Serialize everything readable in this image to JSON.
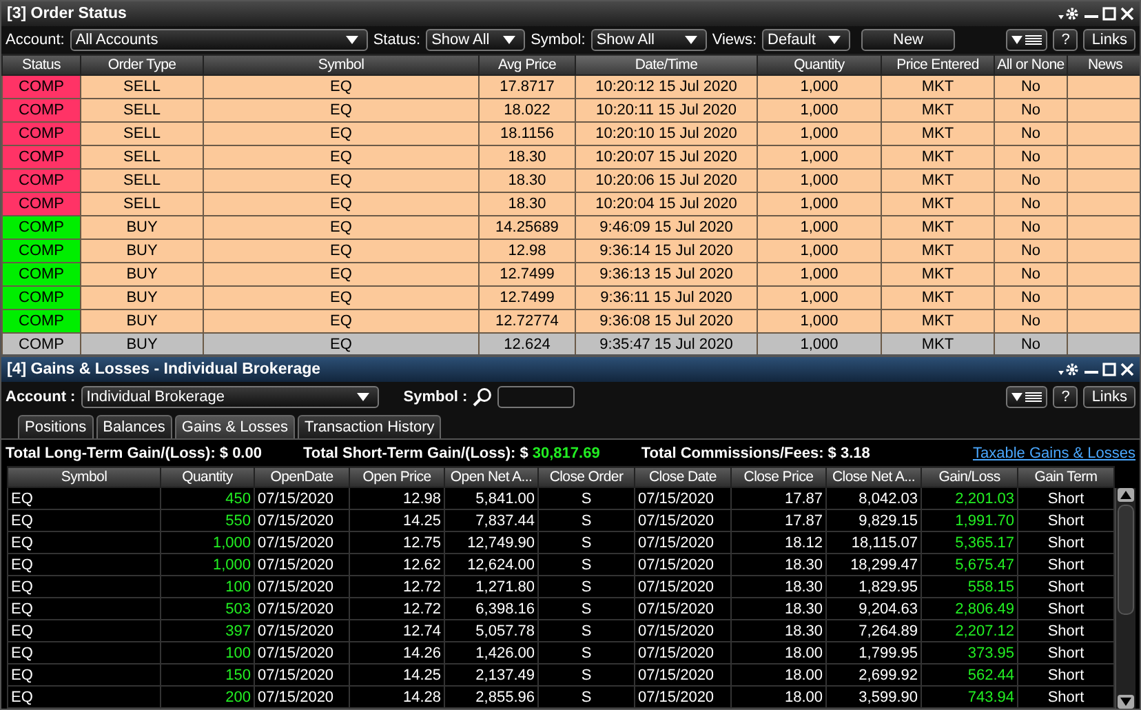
{
  "order_status": {
    "title": "[3] Order Status",
    "toolbar": {
      "account_label": "Account:",
      "account_value": "All Accounts",
      "status_label": "Status:",
      "status_value": "Show All",
      "symbol_label": "Symbol:",
      "symbol_value": "Show All",
      "views_label": "Views:",
      "views_value": "Default",
      "new_button": "New",
      "help_button": "?",
      "links_button": "Links"
    },
    "columns": [
      "Status",
      "Order Type",
      "Symbol",
      "Avg Price",
      "Date/Time",
      "Quantity",
      "Price Entered",
      "All or None",
      "News"
    ],
    "rows": [
      {
        "status": "COMP",
        "color": "#ff3366",
        "order_type": "SELL",
        "symbol": "EQ",
        "avg_price": "17.8717",
        "datetime": "10:20:12 15 Jul 2020",
        "quantity": "1,000",
        "price_entered": "MKT",
        "all_or_none": "No",
        "selected": false
      },
      {
        "status": "COMP",
        "color": "#ff3366",
        "order_type": "SELL",
        "symbol": "EQ",
        "avg_price": "18.022",
        "datetime": "10:20:11 15 Jul 2020",
        "quantity": "1,000",
        "price_entered": "MKT",
        "all_or_none": "No",
        "selected": false
      },
      {
        "status": "COMP",
        "color": "#ff3366",
        "order_type": "SELL",
        "symbol": "EQ",
        "avg_price": "18.1156",
        "datetime": "10:20:10 15 Jul 2020",
        "quantity": "1,000",
        "price_entered": "MKT",
        "all_or_none": "No",
        "selected": false
      },
      {
        "status": "COMP",
        "color": "#ff3366",
        "order_type": "SELL",
        "symbol": "EQ",
        "avg_price": "18.30",
        "datetime": "10:20:07 15 Jul 2020",
        "quantity": "1,000",
        "price_entered": "MKT",
        "all_or_none": "No",
        "selected": false
      },
      {
        "status": "COMP",
        "color": "#ff3366",
        "order_type": "SELL",
        "symbol": "EQ",
        "avg_price": "18.30",
        "datetime": "10:20:06 15 Jul 2020",
        "quantity": "1,000",
        "price_entered": "MKT",
        "all_or_none": "No",
        "selected": false
      },
      {
        "status": "COMP",
        "color": "#ff3366",
        "order_type": "SELL",
        "symbol": "EQ",
        "avg_price": "18.30",
        "datetime": "10:20:04 15 Jul 2020",
        "quantity": "1,000",
        "price_entered": "MKT",
        "all_or_none": "No",
        "selected": false
      },
      {
        "status": "COMP",
        "color": "#00ee00",
        "order_type": "BUY",
        "symbol": "EQ",
        "avg_price": "14.25689",
        "datetime": "9:46:09 15 Jul 2020",
        "quantity": "1,000",
        "price_entered": "MKT",
        "all_or_none": "No",
        "selected": false
      },
      {
        "status": "COMP",
        "color": "#00ee00",
        "order_type": "BUY",
        "symbol": "EQ",
        "avg_price": "12.98",
        "datetime": "9:36:14 15 Jul 2020",
        "quantity": "1,000",
        "price_entered": "MKT",
        "all_or_none": "No",
        "selected": false
      },
      {
        "status": "COMP",
        "color": "#00ee00",
        "order_type": "BUY",
        "symbol": "EQ",
        "avg_price": "12.7499",
        "datetime": "9:36:13 15 Jul 2020",
        "quantity": "1,000",
        "price_entered": "MKT",
        "all_or_none": "No",
        "selected": false
      },
      {
        "status": "COMP",
        "color": "#00ee00",
        "order_type": "BUY",
        "symbol": "EQ",
        "avg_price": "12.7499",
        "datetime": "9:36:11 15 Jul 2020",
        "quantity": "1,000",
        "price_entered": "MKT",
        "all_or_none": "No",
        "selected": false
      },
      {
        "status": "COMP",
        "color": "#00ee00",
        "order_type": "BUY",
        "symbol": "EQ",
        "avg_price": "12.72774",
        "datetime": "9:36:08 15 Jul 2020",
        "quantity": "1,000",
        "price_entered": "MKT",
        "all_or_none": "No",
        "selected": false
      },
      {
        "status": "COMP",
        "color": "#c0c0c0",
        "order_type": "BUY",
        "symbol": "EQ",
        "avg_price": "12.624",
        "datetime": "9:35:47 15 Jul 2020",
        "quantity": "1,000",
        "price_entered": "MKT",
        "all_or_none": "No",
        "selected": true
      }
    ]
  },
  "gains_losses": {
    "title": "[4] Gains & Losses - Individual Brokerage",
    "account_label": "Account :",
    "account_value": "Individual Brokerage",
    "symbol_label": "Symbol :",
    "help_button": "?",
    "links_button": "Links",
    "tabs": [
      {
        "label": "Positions",
        "selected": false
      },
      {
        "label": "Balances",
        "selected": false
      },
      {
        "label": "Gains & Losses",
        "selected": true
      },
      {
        "label": "Transaction History",
        "selected": false
      }
    ],
    "totals": [
      {
        "label": "Total Long-Term Gain/(Loss):",
        "currency": "$",
        "value": "0.00",
        "kind": "plain"
      },
      {
        "label": "Total Short-Term Gain/(Loss):",
        "currency": "$",
        "value": "30,817.69",
        "kind": "gain"
      },
      {
        "label": "Total Commissions/Fees:",
        "currency": "$",
        "value": "3.18",
        "kind": "plain"
      }
    ],
    "link": "Taxable Gains & Losses",
    "columns": [
      "Symbol",
      "Quantity",
      "OpenDate",
      "Open Price",
      "Open Net A...",
      "Close Order",
      "Close Date",
      "Close Price",
      "Close Net A...",
      "Gain/Loss",
      "Gain Term"
    ],
    "rows": [
      [
        "EQ",
        "450",
        "07/15/2020",
        "12.98",
        "5,841.00",
        "S",
        "07/15/2020",
        "17.87",
        "8,042.03",
        "2,201.03",
        "Short"
      ],
      [
        "EQ",
        "550",
        "07/15/2020",
        "14.25",
        "7,837.44",
        "S",
        "07/15/2020",
        "17.87",
        "9,829.15",
        "1,991.70",
        "Short"
      ],
      [
        "EQ",
        "1,000",
        "07/15/2020",
        "12.75",
        "12,749.90",
        "S",
        "07/15/2020",
        "18.12",
        "18,115.07",
        "5,365.17",
        "Short"
      ],
      [
        "EQ",
        "1,000",
        "07/15/2020",
        "12.62",
        "12,624.00",
        "S",
        "07/15/2020",
        "18.30",
        "18,299.47",
        "5,675.47",
        "Short"
      ],
      [
        "EQ",
        "100",
        "07/15/2020",
        "12.72",
        "1,271.80",
        "S",
        "07/15/2020",
        "18.30",
        "1,829.95",
        "558.15",
        "Short"
      ],
      [
        "EQ",
        "503",
        "07/15/2020",
        "12.72",
        "6,398.16",
        "S",
        "07/15/2020",
        "18.30",
        "9,204.63",
        "2,806.49",
        "Short"
      ],
      [
        "EQ",
        "397",
        "07/15/2020",
        "12.74",
        "5,057.78",
        "S",
        "07/15/2020",
        "18.30",
        "7,264.89",
        "2,207.12",
        "Short"
      ],
      [
        "EQ",
        "100",
        "07/15/2020",
        "14.26",
        "1,426.00",
        "S",
        "07/15/2020",
        "18.00",
        "1,799.95",
        "373.95",
        "Short"
      ],
      [
        "EQ",
        "150",
        "07/15/2020",
        "14.25",
        "2,137.49",
        "S",
        "07/15/2020",
        "18.00",
        "2,699.92",
        "562.44",
        "Short"
      ],
      [
        "EQ",
        "200",
        "07/15/2020",
        "14.28",
        "2,855.96",
        "S",
        "07/15/2020",
        "18.00",
        "3,599.90",
        "743.94",
        "Short"
      ]
    ]
  }
}
